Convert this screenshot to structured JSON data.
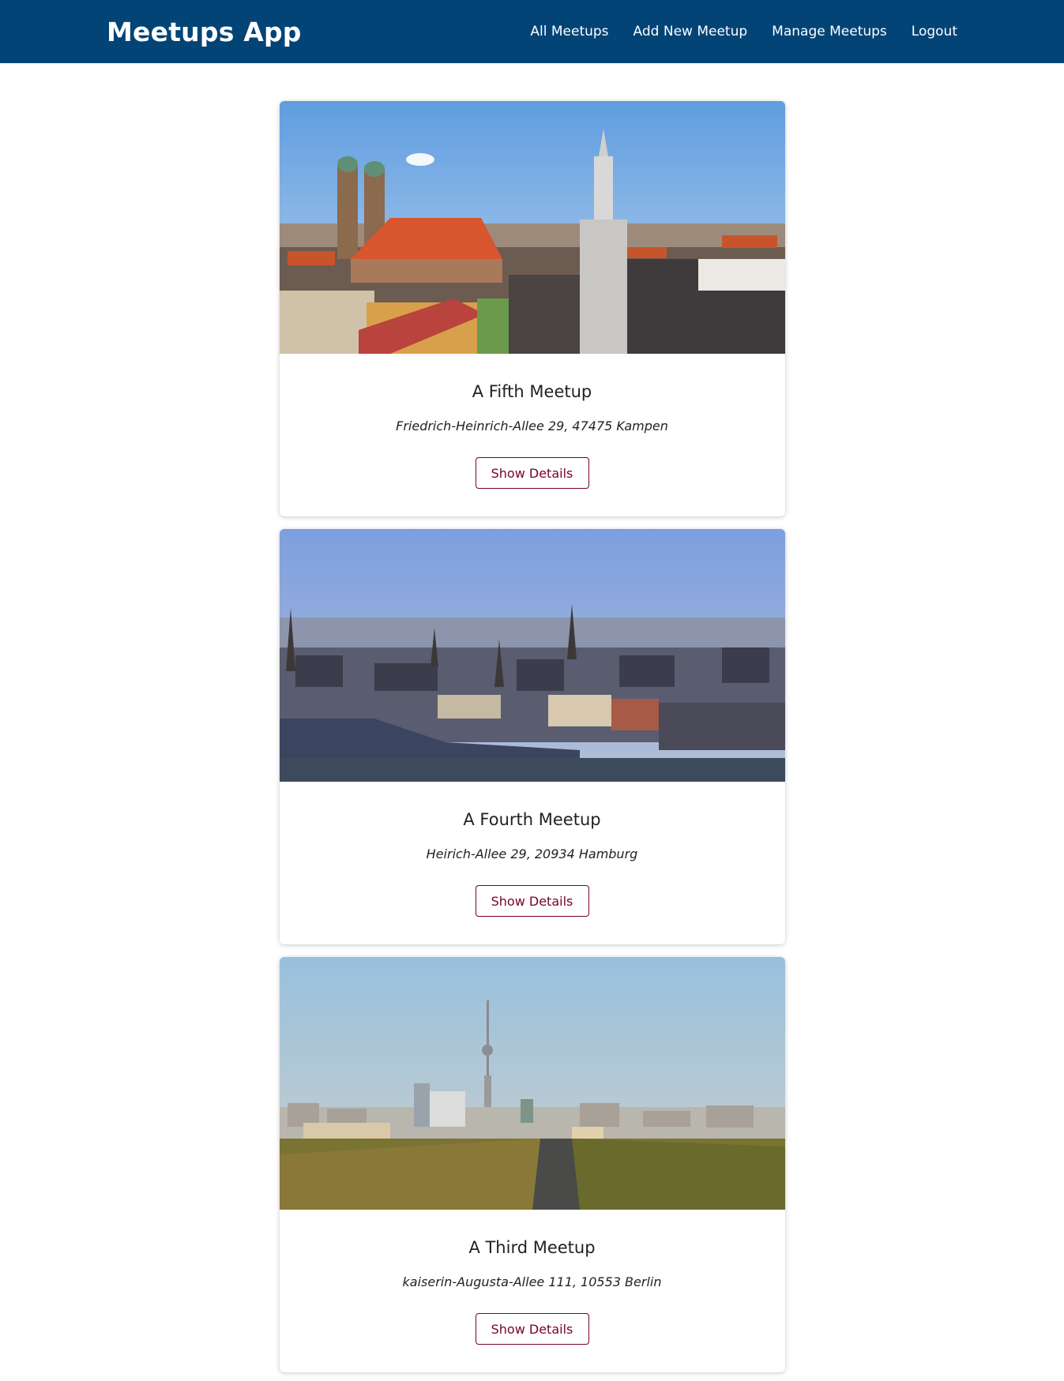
{
  "header": {
    "title": "Meetups App",
    "nav": [
      "All Meetups",
      "Add New Meetup",
      "Manage Meetups",
      "Logout"
    ]
  },
  "meetups": [
    {
      "title": "A Fifth Meetup",
      "address": "Friedrich-Heinrich-Allee 29, 47475 Kampen",
      "button": "Show Details"
    },
    {
      "title": "A Fourth Meetup",
      "address": "Heirich-Allee 29, 20934 Hamburg",
      "button": "Show Details"
    },
    {
      "title": "A Third Meetup",
      "address": "kaiserin-Augusta-Allee 111, 10553 Berlin",
      "button": "Show Details"
    }
  ],
  "colors": {
    "header_bg": "#024476",
    "button_accent": "#77002e"
  }
}
